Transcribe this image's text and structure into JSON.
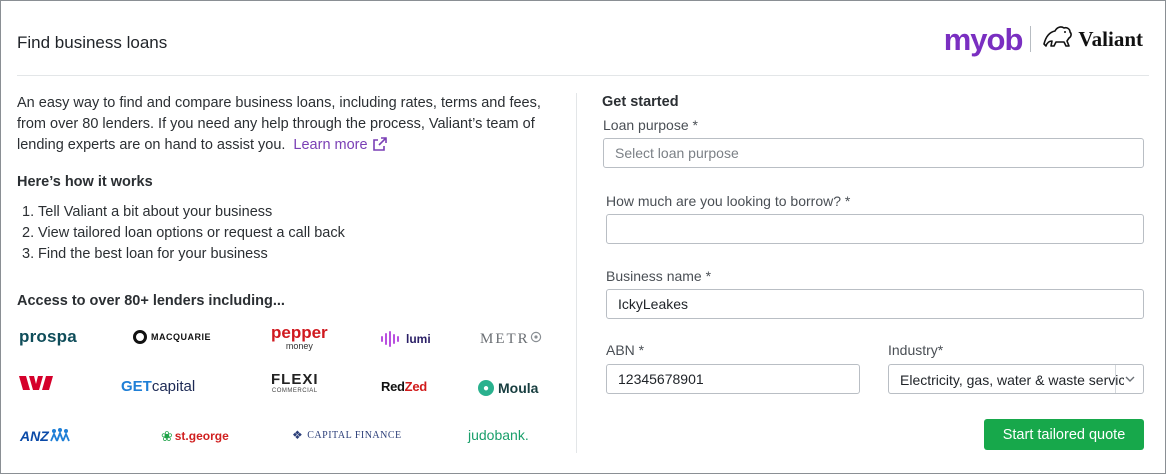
{
  "header": {
    "title": "Find business loans",
    "brand_myob": "myob",
    "brand_valiant": "Valiant"
  },
  "intro": {
    "text": "An easy way to find and compare business loans, including rates, terms and fees, from over 80 lenders. If you need any help through the process, Valiant’s team of lending experts are on hand to assist you.",
    "learn_more": "Learn more"
  },
  "how_it_works": {
    "title": "Here’s how it works",
    "steps": [
      {
        "num": "1.",
        "text": "Tell Valiant a bit about your business"
      },
      {
        "num": "2.",
        "text": "View tailored loan options or request a call back"
      },
      {
        "num": "3.",
        "text": "Find the best loan for your business"
      }
    ]
  },
  "lenders": {
    "title": "Access to over 80+ lenders including...",
    "logos": [
      {
        "name": "prospa",
        "text": "prospa"
      },
      {
        "name": "macquarie",
        "text": "MACQUARIE"
      },
      {
        "name": "pepper",
        "text": "pepper",
        "sub": "money"
      },
      {
        "name": "lumi",
        "text": "lumi"
      },
      {
        "name": "metro",
        "text": "METR"
      },
      {
        "name": "westpac",
        "text": "W"
      },
      {
        "name": "getcapital",
        "text_a": "GET",
        "text_b": "capital"
      },
      {
        "name": "flexi",
        "text": "FLEXI",
        "sub": "COMMERCIAL"
      },
      {
        "name": "redzed",
        "text_a": "Red",
        "text_b": "Zed"
      },
      {
        "name": "moula",
        "text": "Moula"
      },
      {
        "name": "anz",
        "text": "ANZ"
      },
      {
        "name": "stgeorge",
        "text": "st.george"
      },
      {
        "name": "capital-finance",
        "text": "CAPITAL FINANCE"
      },
      {
        "name": "judobank",
        "text": "judobank."
      }
    ]
  },
  "form": {
    "title": "Get started",
    "loan_purpose": {
      "label": "Loan purpose *",
      "placeholder": "Select loan purpose",
      "value": ""
    },
    "borrow_amount": {
      "label": "How much are you looking to borrow? *",
      "value": ""
    },
    "business_name": {
      "label": "Business name *",
      "value": "IckyLeakes"
    },
    "abn": {
      "label": "ABN *",
      "value": "12345678901"
    },
    "industry": {
      "label": "Industry*",
      "value": "Electricity, gas, water & waste services"
    },
    "submit_label": "Start tailored quote"
  },
  "colors": {
    "accent_green": "#17a84b",
    "link_purple": "#7a3fb5",
    "myob_purple": "#7a2fc1"
  }
}
